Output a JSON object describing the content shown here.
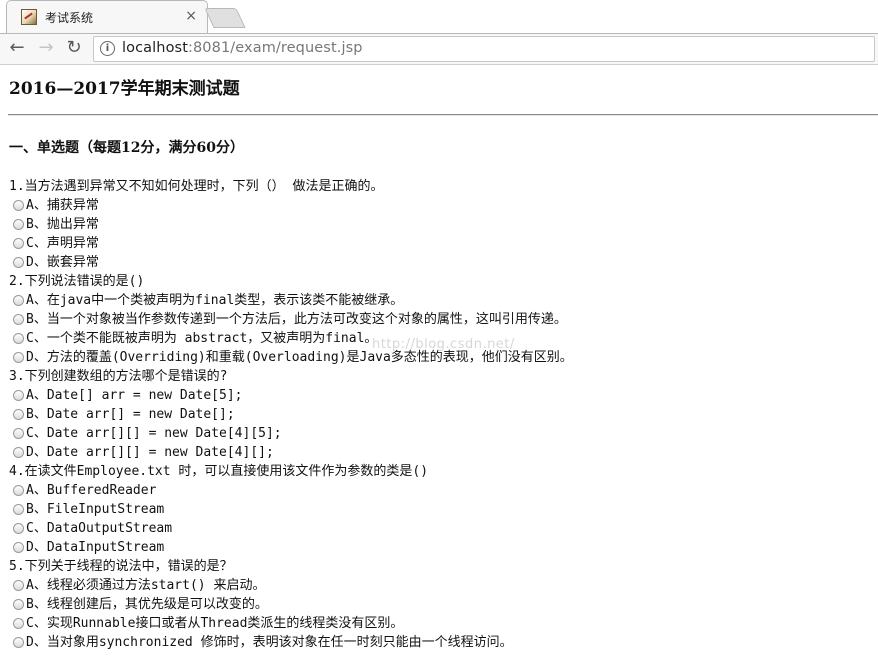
{
  "browser": {
    "tab_title": "考试系统",
    "close_glyph": "×",
    "url_host": "localhost",
    "url_rest": ":8081/exam/request.jsp"
  },
  "page": {
    "title": "2016—2017学年期末测试题",
    "section_title": "一、单选题（每题12分，满分60分）",
    "watermark": "http://blog.csdn.net/"
  },
  "questions": [
    {
      "stem": "1.当方法遇到异常又不知如何处理时，下列（）  做法是正确的。",
      "options": [
        "A、捕获异常",
        "B、抛出异常",
        "C、声明异常",
        "D、嵌套异常"
      ]
    },
    {
      "stem": "2.下列说法错误的是()",
      "options": [
        "A、在java中一个类被声明为final类型，表示该类不能被继承。",
        "B、当一个对象被当作参数传递到一个方法后，此方法可改变这个对象的属性，这叫引用传递。",
        "C、一个类不能既被声明为 abstract，又被声明为final。",
        "D、方法的覆盖(Overriding)和重载(Overloading)是Java多态性的表现，他们没有区别。"
      ]
    },
    {
      "stem": "3.下列创建数组的方法哪个是错误的?",
      "options": [
        "A、Date[] arr = new Date[5];",
        "B、Date arr[] = new Date[];",
        "C、Date arr[][] = new Date[4][5];",
        "D、Date arr[][] = new Date[4][];"
      ]
    },
    {
      "stem": "4.在读文件Employee.txt 时，可以直接使用该文件作为参数的类是()",
      "options": [
        "A、BufferedReader",
        "B、FileInputStream",
        "C、DataOutputStream",
        "D、DataInputStream"
      ]
    },
    {
      "stem": "5.下列关于线程的说法中，错误的是？",
      "options": [
        "A、线程必须通过方法start() 来启动。",
        "B、线程创建后，其优先级是可以改变的。",
        "C、实现Runnable接口或者从Thread类派生的线程类没有区别。",
        "D、当对象用synchronized 修饰时，表明该对象在任一时刻只能由一个线程访问。"
      ]
    }
  ]
}
